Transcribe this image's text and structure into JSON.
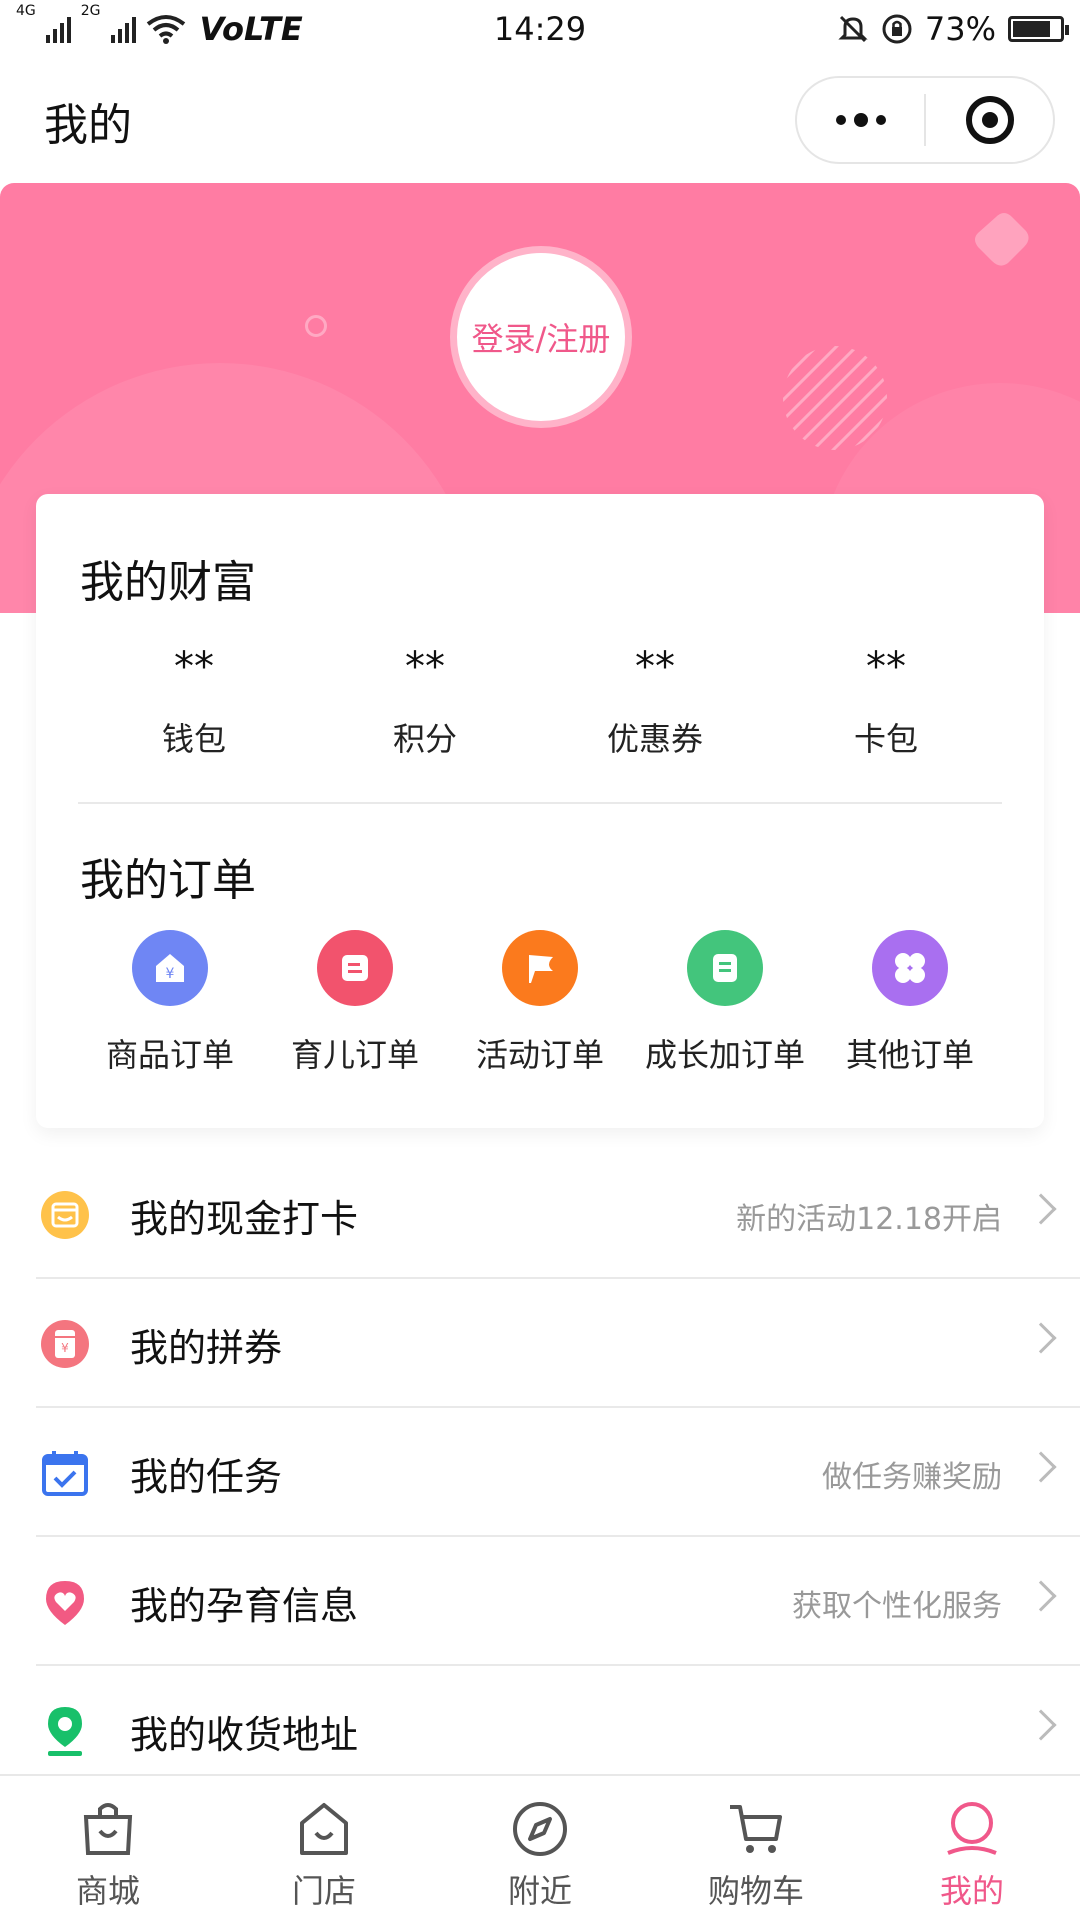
{
  "status_bar": {
    "net1": "4G",
    "net2": "2G",
    "volte": "VoLTE",
    "time": "14:29",
    "battery_pct": "73%",
    "battery_level": 0.73
  },
  "header": {
    "title": "我的"
  },
  "banner": {
    "login_label": "登录/注册",
    "color": "#ff7ca3"
  },
  "wealth": {
    "title": "我的财富",
    "items": [
      {
        "value": "**",
        "label": "钱包"
      },
      {
        "value": "**",
        "label": "积分"
      },
      {
        "value": "**",
        "label": "优惠券"
      },
      {
        "value": "**",
        "label": "卡包"
      }
    ]
  },
  "orders": {
    "title": "我的订单",
    "items": [
      {
        "label": "商品订单",
        "icon": "shop-order-icon",
        "color": "#6f86f4"
      },
      {
        "label": "育儿订单",
        "icon": "parenting-order-icon",
        "color": "#f2536d"
      },
      {
        "label": "活动订单",
        "icon": "flag-icon",
        "color": "#fb7a1d"
      },
      {
        "label": "成长加订单",
        "icon": "document-icon",
        "color": "#43c57c"
      },
      {
        "label": "其他订单",
        "icon": "clover-icon",
        "color": "#a96ff0"
      }
    ]
  },
  "menu": [
    {
      "title": "我的现金打卡",
      "hint": "新的活动12.18开启",
      "icon": "cash-checkin-icon"
    },
    {
      "title": "我的拼券",
      "hint": "",
      "icon": "coupon-icon"
    },
    {
      "title": "我的任务",
      "hint": "做任务赚奖励",
      "icon": "calendar-check-icon"
    },
    {
      "title": "我的孕育信息",
      "hint": "获取个性化服务",
      "icon": "heart-icon"
    },
    {
      "title": "我的收货地址",
      "hint": "",
      "icon": "location-pin-icon"
    }
  ],
  "tabbar": {
    "items": [
      {
        "label": "商城",
        "icon": "shopping-bag-icon"
      },
      {
        "label": "门店",
        "icon": "store-icon"
      },
      {
        "label": "附近",
        "icon": "compass-icon"
      },
      {
        "label": "购物车",
        "icon": "cart-icon"
      },
      {
        "label": "我的",
        "icon": "profile-icon"
      }
    ],
    "active_index": 4,
    "active_color": "#f0588a"
  }
}
